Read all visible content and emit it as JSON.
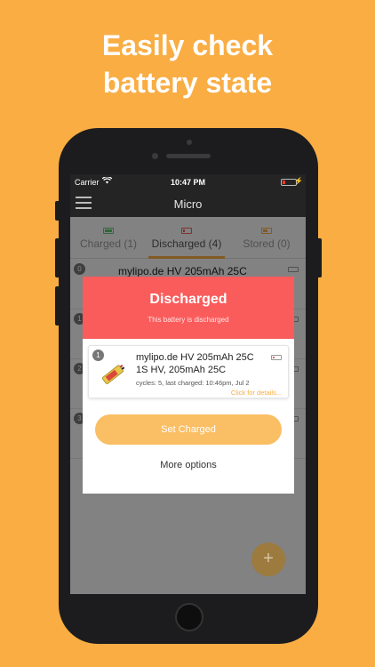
{
  "headline": {
    "line1": "Easily check",
    "line2": "battery state"
  },
  "statusbar": {
    "carrier": "Carrier",
    "time": "10:47 PM",
    "wifi_icon": "wifi-icon",
    "battery_icon": "battery-low-icon"
  },
  "navbar": {
    "title": "Micro",
    "menu_icon": "hamburger-icon"
  },
  "tabs": [
    {
      "label": "Charged (1)",
      "color": "#5cc96b"
    },
    {
      "label": "Discharged (4)",
      "color": "#FA5C5C"
    },
    {
      "label": "Stored (0)",
      "color": "#F9AD43"
    }
  ],
  "list": [
    {
      "num": "0",
      "title": "mylipo.de HV 205mAh 25C"
    },
    {
      "num": "1",
      "title": ""
    },
    {
      "num": "2",
      "title": ""
    },
    {
      "num": "3",
      "title": ""
    }
  ],
  "modal": {
    "title": "Discharged",
    "subtitle": "This battery is discharged",
    "header_color": "#FA5C5C",
    "card": {
      "num": "1",
      "title_line1": "mylipo.de HV 205mAh 25C",
      "title_line2": "1S HV, 205mAh 25C",
      "meta": "cycles: 5, last charged: 10:46pm, Jul 2",
      "link": "Click for details..."
    },
    "primary_button": "Set Charged",
    "secondary_button": "More options"
  },
  "fab": {
    "label": "+"
  },
  "colors": {
    "background": "#F9AD43",
    "accent": "#F9AD43",
    "danger": "#FA5C5C"
  }
}
